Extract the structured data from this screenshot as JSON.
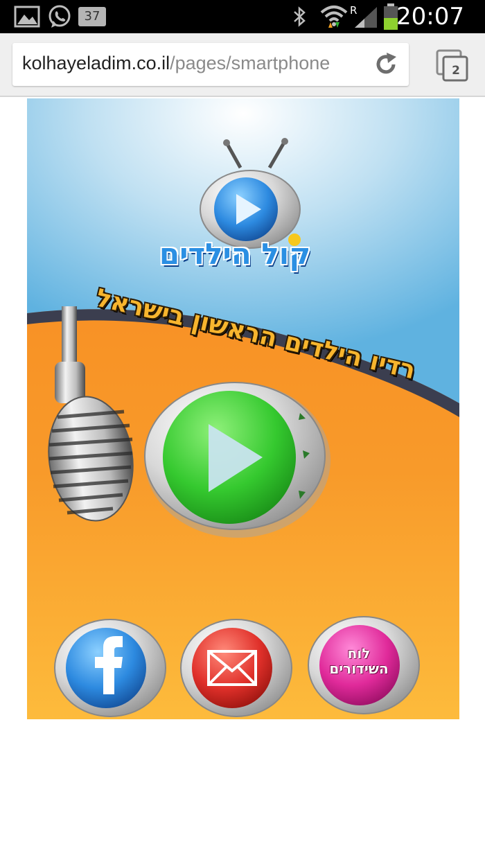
{
  "status_bar": {
    "time": "20:07",
    "notification_count": "37",
    "roaming_indicator": "R",
    "icons": [
      "gallery-icon",
      "whatsapp-icon",
      "bluetooth-icon",
      "wifi-icon",
      "signal-icon",
      "battery-icon"
    ]
  },
  "browser": {
    "url_domain": "kolhayeladim.co.il",
    "url_path": "/pages/smartphone",
    "tab_count": "2"
  },
  "app": {
    "logo_text": "קול הילדים",
    "slogan": "רדיו הילדים הראשון בישראל",
    "buttons": {
      "play": "play-icon",
      "facebook": "facebook-icon",
      "email": "envelope-icon",
      "schedule_line1": "לוח",
      "schedule_line2": "השידורים"
    }
  },
  "colors": {
    "sky_blue": "#5fb2e0",
    "orange": "#f7921e",
    "play_green": "#3fcf3a",
    "facebook_blue": "#2d8ae0",
    "email_red": "#e0302a",
    "schedule_pink": "#e02a9a"
  }
}
